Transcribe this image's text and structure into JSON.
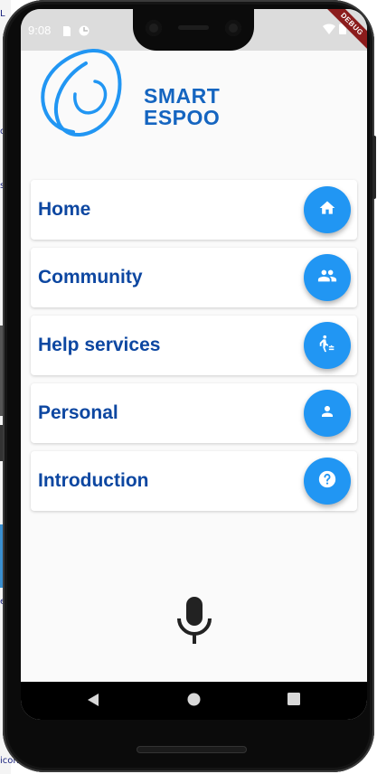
{
  "status_bar": {
    "time": "9:08",
    "icons": [
      "sd-card-icon",
      "data-saver-icon",
      "wifi-icon",
      "battery-icon"
    ]
  },
  "debug_banner": "DEBUG",
  "background_fragments": [
    "L",
    "o",
    "s",
    "e",
    "icon"
  ],
  "logo": {
    "line1": "SMART",
    "line2": "ESPOO"
  },
  "menu": [
    {
      "label": "Home",
      "icon": "home-icon"
    },
    {
      "label": "Community",
      "icon": "people-icon"
    },
    {
      "label": "Help services",
      "icon": "elderly-help-icon"
    },
    {
      "label": "Personal",
      "icon": "person-icon"
    },
    {
      "label": "Introduction",
      "icon": "help-circle-icon"
    }
  ],
  "nav_bar": [
    "back-icon",
    "home-circle-icon",
    "recents-icon"
  ],
  "colors": {
    "primary_blue": "#2196f3",
    "label_blue": "#0d47a1",
    "logo_blue": "#1565c0",
    "screen_bg": "#fafafa",
    "statusbar": "#dcdcdc"
  }
}
